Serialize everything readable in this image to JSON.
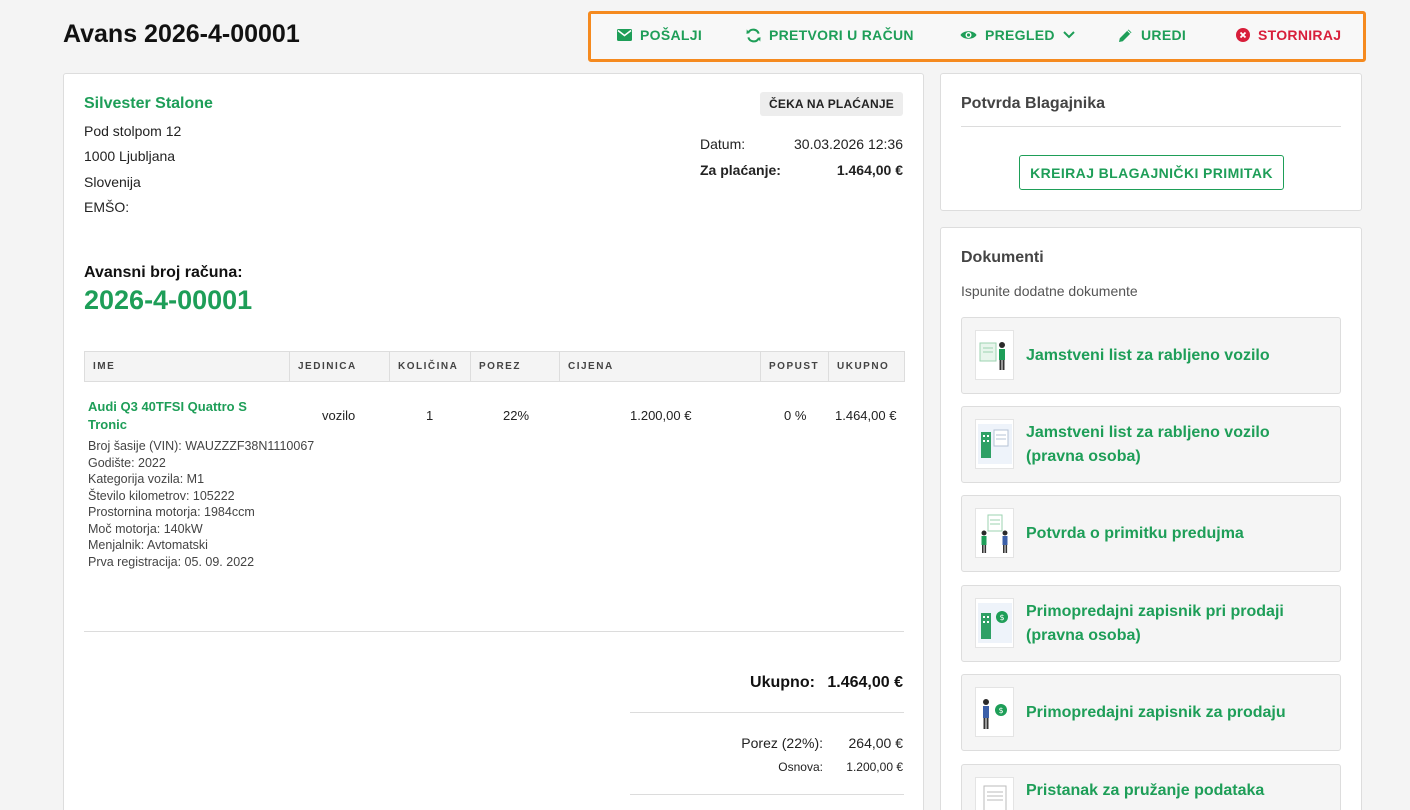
{
  "page": {
    "title": "Avans 2026-4-00001"
  },
  "toolbar": {
    "send": "POŠALJI",
    "convert": "PRETVORI U RAČUN",
    "preview": "PREGLED",
    "edit": "UREDI",
    "cancel": "STORNIRAJ"
  },
  "client": {
    "name": "Silvester Stalone",
    "street": "Pod stolpom 12",
    "city": "1000 Ljubljana",
    "country": "Slovenija",
    "emso_label": "EMŠO:"
  },
  "status": "ČEKA NA PLAĆANJE",
  "meta": {
    "date_label": "Datum:",
    "date_value": "30.03.2026 12:36",
    "due_label": "Za plaćanje:",
    "due_value": "1.464,00 €"
  },
  "advance": {
    "label": "Avansni broj računa:",
    "number": "2026-4-00001"
  },
  "table": {
    "headers": [
      "IME",
      "JEDINICA",
      "KOLIČINA",
      "POREZ",
      "CIJENA",
      "POPUST",
      "UKUPNO"
    ],
    "rows": [
      {
        "name": "Audi Q3 40TFSI Quattro S Tronic",
        "unit": "vozilo",
        "qty": "1",
        "tax": "22%",
        "price": "1.200,00 €",
        "discount": "0 %",
        "total": "1.464,00 €",
        "details": [
          "Broj šasije (VIN): WAUZZZF38N1110067",
          "Godište: 2022",
          "Kategorija vozila: M1",
          "Število kilometrov: 105222",
          "Prostornina motorja: 1984ccm",
          "Moč motorja: 140kW",
          "Menjalnik: Avtomatski",
          "Prva registracija: 05. 09. 2022"
        ]
      }
    ]
  },
  "totals": {
    "total_label": "Ukupno:",
    "total_value": "1.464,00 €",
    "tax_label": "Porez (22%):",
    "tax_value": "264,00 €",
    "base_label": "Osnova:",
    "base_value": "1.200,00 €"
  },
  "cashier": {
    "title": "Potvrda Blagajnika",
    "button": "KREIRAJ BLAGAJNIČKI PRIMITAK"
  },
  "documents": {
    "title": "Dokumenti",
    "subtitle": "Ispunite dodatne dokumente",
    "items": [
      "Jamstveni list za rabljeno vozilo",
      "Jamstveni list za rabljeno vozilo (pravna osoba)",
      "Potvrda o primitku predujma",
      "Primopredajni zapisnik pri prodaji (pravna osoba)",
      "Primopredajni zapisnik za prodaju",
      "Pristanak za pružanje podataka"
    ]
  },
  "colors": {
    "accent": "#1e9e58",
    "danger": "#d81e3a",
    "highlight": "#f58a1f"
  },
  "icons": {
    "send": "envelope-icon",
    "convert": "refresh-icon",
    "preview": "eye-icon",
    "edit": "pencil-icon",
    "cancel": "times-circle-icon"
  }
}
